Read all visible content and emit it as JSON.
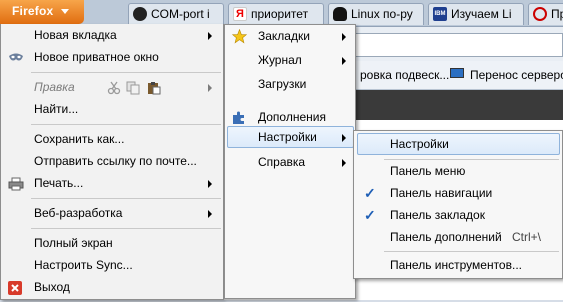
{
  "firefox_button": {
    "label": "Firefox"
  },
  "tabs": [
    {
      "title": "COM-port i",
      "icon": "github-icon"
    },
    {
      "title": "приоритет",
      "icon": "yandex-icon"
    },
    {
      "title": "Linux по-ру",
      "icon": "tux-icon"
    },
    {
      "title": "Изучаем Li",
      "icon": "ibm-icon"
    },
    {
      "title": "Пр",
      "icon": "mail-icon"
    }
  ],
  "bookmarks_toolbar": [
    {
      "label": "ровка подвеск..."
    },
    {
      "label": "Перенос серверо"
    }
  ],
  "main_menu": {
    "new_tab": "Новая вкладка",
    "new_private_window": "Новое приватное окно",
    "edit": "Правка",
    "find": "Найти...",
    "save_as": "Сохранить как...",
    "send_link": "Отправить ссылку по почте...",
    "print": "Печать...",
    "web_developer": "Веб-разработка",
    "full_screen": "Полный экран",
    "setup_sync": "Настроить Sync...",
    "quit": "Выход"
  },
  "submenu": {
    "bookmarks": "Закладки",
    "history": "Журнал",
    "downloads": "Загрузки",
    "addons": "Дополнения",
    "options": "Настройки",
    "help": "Справка"
  },
  "options_submenu": {
    "options": "Настройки",
    "menu_bar": "Панель меню",
    "navigation_toolbar": "Панель навигации",
    "bookmarks_toolbar": "Панель закладок",
    "addon_bar": "Панель дополнений",
    "addon_bar_shortcut": "Ctrl+\\",
    "customize": "Панель инструментов...",
    "menu_bar_checked": false,
    "navigation_toolbar_checked": true,
    "bookmarks_toolbar_checked": true,
    "addon_bar_checked": false
  },
  "colors": {
    "firefox_orange": "#e06d10",
    "highlight_border": "#8fb3db",
    "check_blue": "#1f5fb6"
  }
}
